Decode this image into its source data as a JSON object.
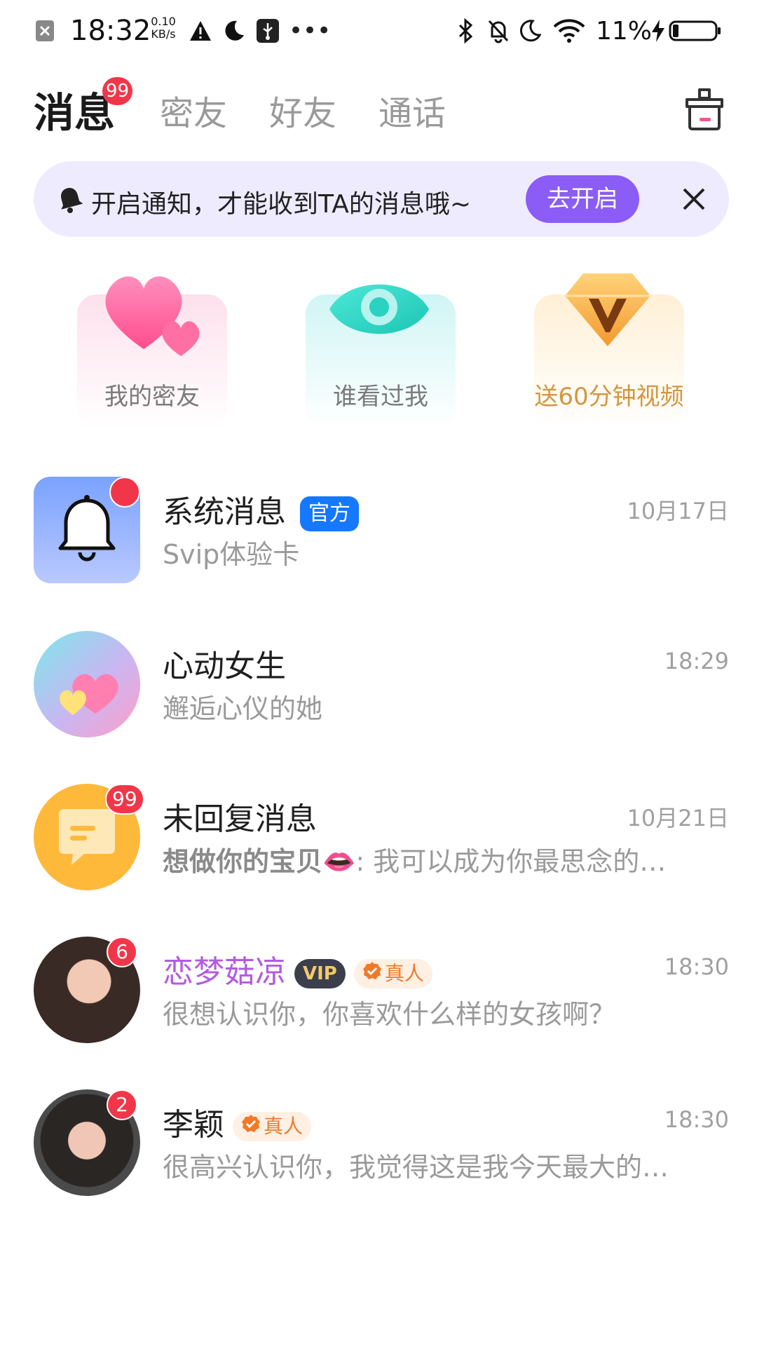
{
  "status_bar": {
    "time": "18:32",
    "net_speed_value": "0.10",
    "net_speed_unit": "KB/s",
    "battery": "11%",
    "icons": [
      "close-square-icon",
      "warning-icon",
      "moon-icon",
      "usb-icon",
      "more-dots-icon",
      "bluetooth-icon",
      "bell-off-icon",
      "moon-icon",
      "wifi-icon",
      "charging-icon",
      "battery-icon"
    ]
  },
  "tabs": [
    {
      "label": "消息",
      "active": true,
      "badge": "99"
    },
    {
      "label": "密友"
    },
    {
      "label": "好友"
    },
    {
      "label": "通话"
    }
  ],
  "notify_banner": {
    "text": "开启通知，才能收到TA的消息哦~",
    "button": "去开启"
  },
  "quick_cards": [
    {
      "label": "我的密友",
      "color": "#7a7a7a",
      "bg": "#fde3ee"
    },
    {
      "label": "谁看过我",
      "color": "#7a7a7a",
      "bg": "#d7f6f6"
    },
    {
      "label": "送60分钟视频",
      "color": "#d4963f",
      "bg": "#fff2dc"
    }
  ],
  "conversations": [
    {
      "title": "系统消息",
      "tag": "官方",
      "subtitle": "Svip体验卡",
      "time": "10月17日"
    },
    {
      "title": "心动女生",
      "subtitle": "邂逅心仪的她",
      "time": "18:29"
    },
    {
      "title": "未回复消息",
      "badge": "99",
      "subtitle_bold": "想做你的宝贝",
      "subtitle_emoji": "👄",
      "subtitle": ": 我可以成为你最思念的…",
      "time": "10月21日"
    },
    {
      "title": "恋梦菇凉",
      "badge": "6",
      "vip": "VIP",
      "tag": "真人",
      "subtitle": "很想认识你，你喜欢什么样的女孩啊？",
      "time": "18:30"
    },
    {
      "title": "李颖",
      "badge": "2",
      "tag": "真人",
      "subtitle": "很高兴认识你，我觉得这是我今天最大的…",
      "time": "18:30"
    }
  ],
  "colors": {
    "accent_purple": "#8b5cf6",
    "badge_red": "#f2364a",
    "official_blue": "#1677ff",
    "vip_purple_name": "#b35be0",
    "real_tag_orange": "#f07a2a"
  }
}
